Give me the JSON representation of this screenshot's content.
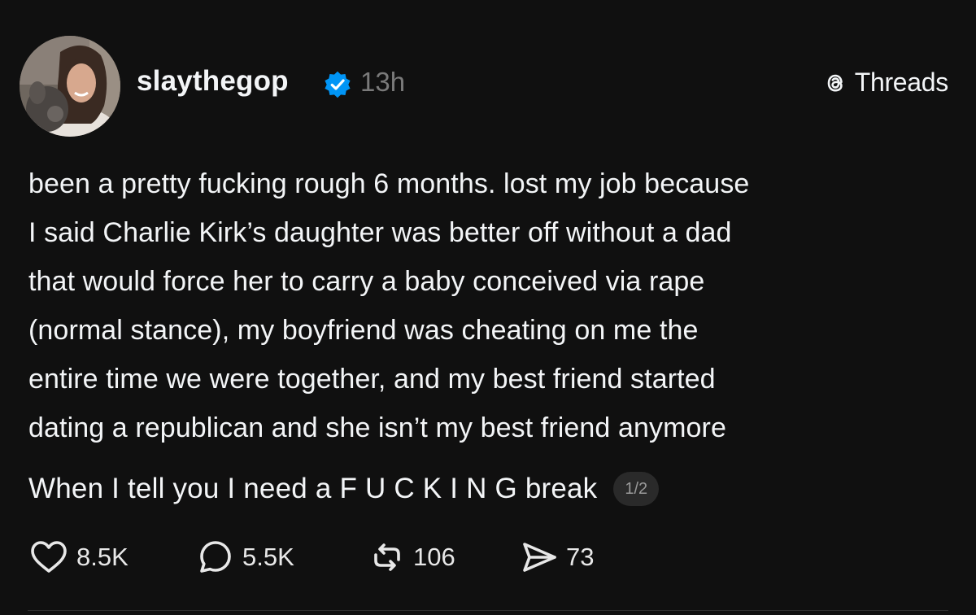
{
  "post": {
    "username": "slaythegop",
    "timestamp": "13h",
    "brand": "Threads",
    "body": "been a pretty fucking rough 6 months. lost my job because\nI said Charlie Kirk’s daughter was better off without a dad\nthat would force her to carry a baby conceived via rape\n(normal stance), my boyfriend was cheating on me the\nentire time we were together, and my best friend started\ndating a republican and she isn’t my best friend anymore",
    "second_line": "When I tell you I need a F U C K I N G break",
    "page_indicator": "1/2"
  },
  "actions": {
    "likes": "8.5K",
    "replies": "5.5K",
    "reposts": "106",
    "shares": "73"
  },
  "icons": {
    "verified": "verified-badge-icon",
    "brand": "threads-logo-icon",
    "like": "heart-icon",
    "reply": "speech-bubble-icon",
    "repost": "repost-icon",
    "share": "paper-plane-icon"
  },
  "colors": {
    "background": "#101010",
    "text": "#f3f5f7",
    "muted": "#7a7a7a",
    "verified": "#0095f6"
  }
}
